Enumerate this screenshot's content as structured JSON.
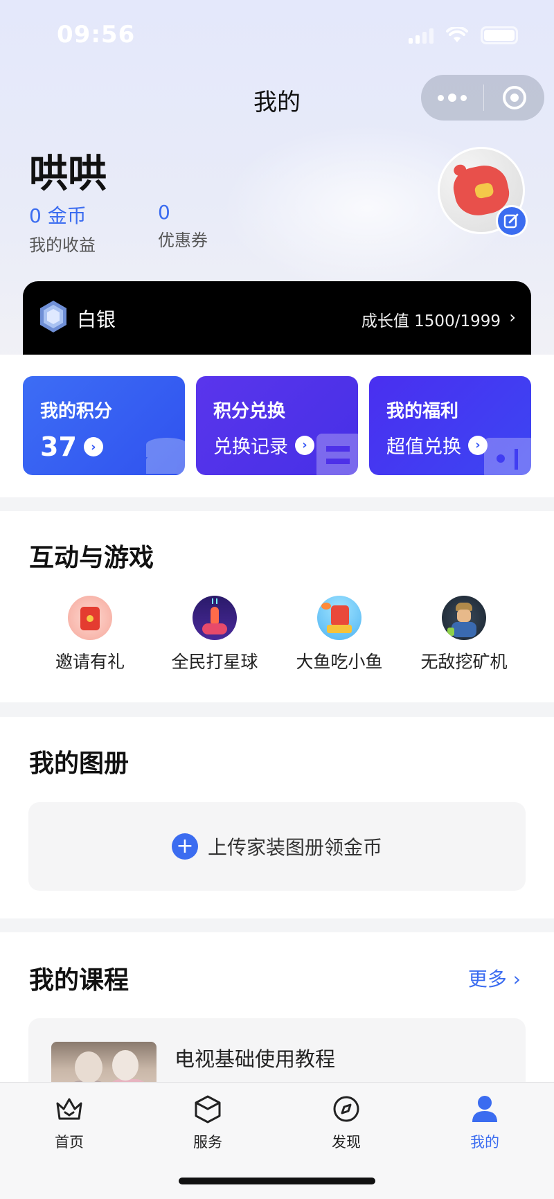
{
  "status": {
    "time": "09:56"
  },
  "nav": {
    "title": "我的"
  },
  "profile": {
    "username": "哄哄",
    "coins_value": "0 金币",
    "coins_label": "我的收益",
    "coupons_value": "0",
    "coupons_label": "优惠券"
  },
  "level": {
    "name": "白银",
    "growth": "成长值  1500/1999"
  },
  "cards": [
    {
      "title": "我的积分",
      "value": "37"
    },
    {
      "title": "积分兑换",
      "sub": "兑换记录"
    },
    {
      "title": "我的福利",
      "sub": "超值兑换"
    }
  ],
  "games": {
    "title": "互动与游戏",
    "items": [
      {
        "name": "邀请有礼",
        "icon": "red-envelope-icon"
      },
      {
        "name": "全民打星球",
        "icon": "rocket-game-icon"
      },
      {
        "name": "大鱼吃小鱼",
        "icon": "fish-game-icon"
      },
      {
        "name": "无敌挖矿机",
        "icon": "miner-game-icon"
      }
    ]
  },
  "album": {
    "title": "我的图册",
    "upload_label": "上传家装图册领金币"
  },
  "courses": {
    "title": "我的课程",
    "more_label": "更多",
    "items": [
      {
        "title": "电视基础使用教程"
      }
    ]
  },
  "tabbar": {
    "items": [
      {
        "label": "首页",
        "icon": "crown-home-icon"
      },
      {
        "label": "服务",
        "icon": "box-service-icon"
      },
      {
        "label": "发现",
        "icon": "compass-icon"
      },
      {
        "label": "我的",
        "icon": "user-icon",
        "active": true
      }
    ]
  },
  "colors": {
    "accent": "#3b6cf0",
    "level_bar": "#000000"
  }
}
